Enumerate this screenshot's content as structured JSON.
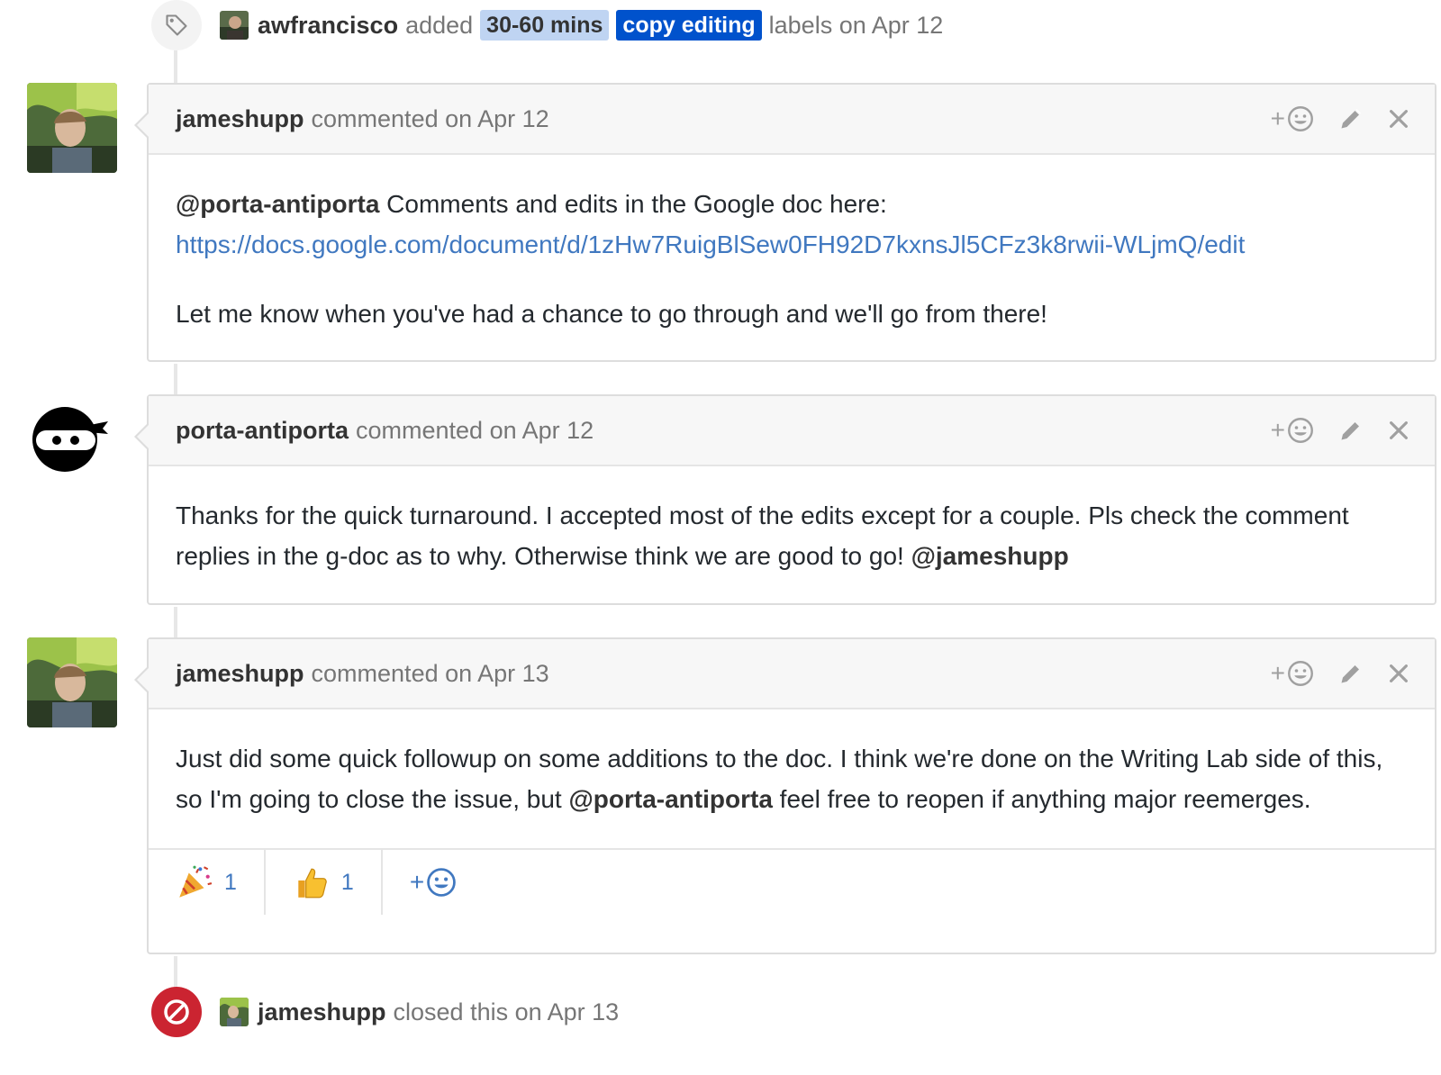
{
  "label_event": {
    "author": "awfrancisco",
    "verb": "added",
    "labels": [
      {
        "name": "30-60 mins",
        "bg": "#bfd4f2",
        "fg": "#333333"
      },
      {
        "name": "copy editing",
        "bg": "#0052cc",
        "fg": "#ffffff"
      }
    ],
    "suffix": "labels on Apr 12",
    "badge_icon": "tag-icon"
  },
  "comments": [
    {
      "author": "jameshupp",
      "meta": "commented on Apr 12",
      "mention": "@porta-antiporta",
      "text_after_mention": " Comments and edits in the Google doc here:",
      "link": "https://docs.google.com/document/d/1zHw7RuigBlSew0FH92D7kxnsJl5CFz3k8rwii-WLjmQ/edit",
      "paragraph2": "Let me know when you've had a chance to go through and we'll go from there!"
    },
    {
      "author": "porta-antiporta",
      "meta": "commented on Apr 12",
      "text": "Thanks for the quick turnaround. I accepted most of the edits except for a couple. Pls check the comment replies in the g-doc as to why. Otherwise think we are good to go! ",
      "mention": "@jameshupp"
    },
    {
      "author": "jameshupp",
      "meta": "commented on Apr 13",
      "text_before": "Just did some quick followup on some additions to the doc. I think we're done on the Writing Lab side of this, so I'm going to close the issue, but ",
      "mention": "@porta-antiporta",
      "text_after": " feel free to reopen if anything major reemerges.",
      "reactions": [
        {
          "icon": "party-popper-icon",
          "count": "1"
        },
        {
          "icon": "thumbs-up-icon",
          "count": "1"
        }
      ],
      "add_reaction": "+"
    }
  ],
  "header_actions": {
    "add_reaction": "+"
  },
  "closed_event": {
    "author": "jameshupp",
    "text": "closed this on Apr 13",
    "badge_icon": "circle-slash-icon"
  },
  "colors": {
    "link": "#4078c0",
    "closed": "#cb2431"
  }
}
